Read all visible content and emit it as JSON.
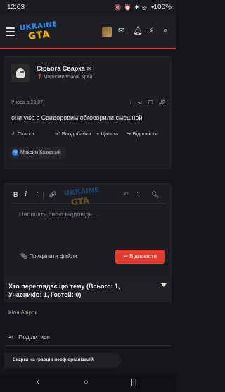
{
  "status_bar": {
    "time": "12:03",
    "icons": "🔇 ⏰ ✱ ◎ ▼",
    "battery": "100%"
  },
  "header": {
    "logo_line1": "UKRAINE",
    "logo_line2": "GTA"
  },
  "post": {
    "author": "Сірьога Сварка",
    "author_mail_icon": "✉",
    "location": "Чорноморський Край",
    "location_icon": "📍",
    "date": "Учора о 23:07",
    "number": "#2",
    "message": "они уже с Свидоровим обговорили,смешной",
    "actions": {
      "report": "Скарга",
      "like": "Вподобайка",
      "quote": "+ Цитата",
      "reply": "Відповісти"
    },
    "reaction_user": "Максим Козирний"
  },
  "editor": {
    "placeholder": "Напишіть свою відповідь...",
    "attach_label": "Прикріпити файли",
    "submit_label": "Відповісти",
    "watermark_line1": "UKRAINE",
    "watermark_line2": "GTA"
  },
  "watchers": {
    "title": "Хто переглядає цю тему (Всього: 1, Учасників: 1, Гостей: 0)",
    "viewer": "Кіля Азіров"
  },
  "share_label": "Поділитися",
  "complaint_label": "Скарги на гравців неоф.організацій",
  "colors": {
    "accent": "#e23b2d",
    "background": "#15161a",
    "card": "#1c1d22"
  }
}
